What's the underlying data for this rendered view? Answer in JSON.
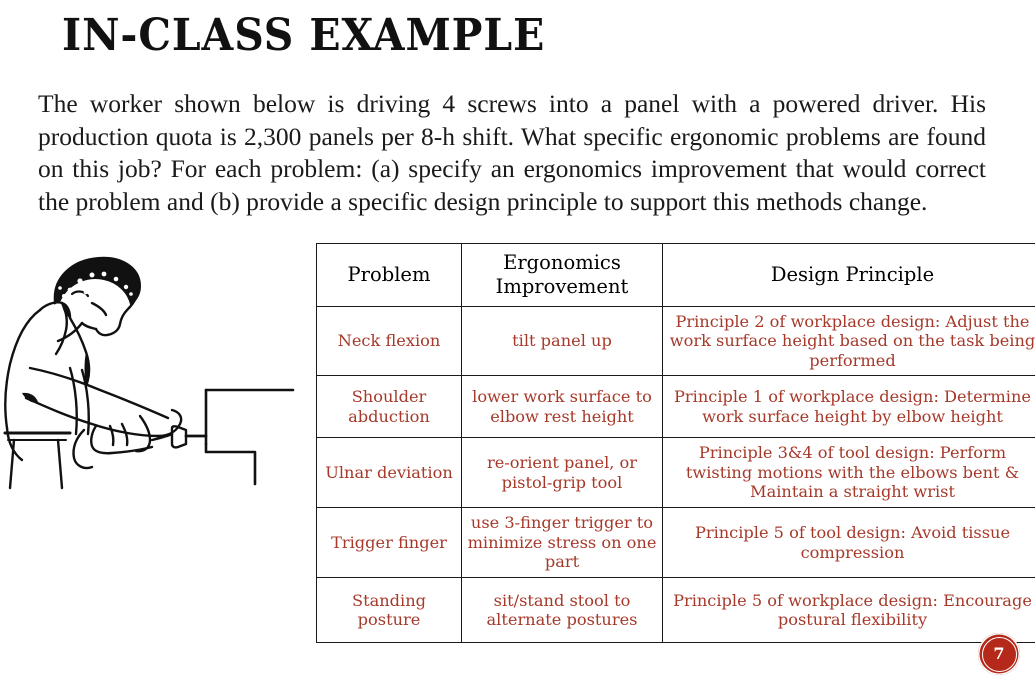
{
  "slide": {
    "title": "IN-CLASS EXAMPLE",
    "page_number": "7",
    "accent_color": "#b5291a",
    "table_text_color": "#a6392a"
  },
  "body": {
    "paragraph": "The worker shown below is driving 4 screws into a panel with a powered driver. His production quota is 2,300 panels per 8-h shift. What specific ergonomic problems are found on this job? For each problem: (a) specify an ergonomics improvement that would correct the problem and (b) provide a specific design principle to support this methods change."
  },
  "figure": {
    "caption": "worker bent over driving screws into a panel with a powered drill"
  },
  "table": {
    "headers": [
      "Problem",
      "Ergonomics Improvement",
      "Design Principle"
    ],
    "rows": [
      {
        "problem": "Neck flexion",
        "improvement": "tilt panel up",
        "principle": "Principle 2 of workplace design: Adjust the work surface height based on the task being performed"
      },
      {
        "problem": "Shoulder abduction",
        "improvement": "lower work surface to elbow rest height",
        "principle": "Principle 1 of workplace design: Determine work surface height by elbow height"
      },
      {
        "problem": "Ulnar deviation",
        "improvement": "re-orient panel, or pistol-grip tool",
        "principle": "Principle 3&4 of tool design: Perform twisting motions with the elbows bent & Maintain a straight wrist"
      },
      {
        "problem": "Trigger finger",
        "improvement": "use 3-finger trigger to minimize stress on one part",
        "principle": "Principle 5 of tool design: Avoid tissue compression"
      },
      {
        "problem": "Standing posture",
        "improvement": "sit/stand stool to alternate postures",
        "principle": "Principle 5 of workplace design: Encourage postural flexibility"
      }
    ]
  }
}
